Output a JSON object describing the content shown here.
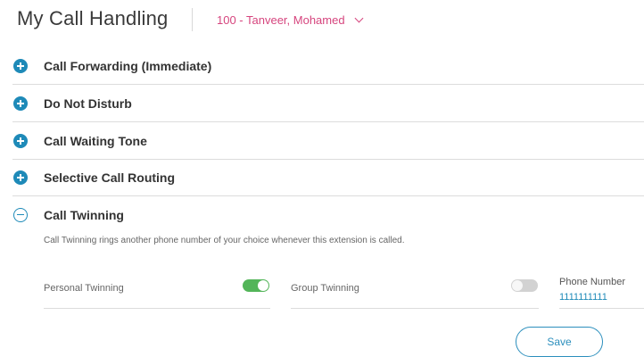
{
  "header": {
    "title": "My Call Handling",
    "extension_selected": "100 - Tanveer, Mohamed"
  },
  "sections": [
    {
      "label": "Call Forwarding (Immediate)",
      "expanded": false
    },
    {
      "label": "Do Not Disturb",
      "expanded": false
    },
    {
      "label": "Call Waiting Tone",
      "expanded": false
    },
    {
      "label": "Selective Call Routing",
      "expanded": false
    }
  ],
  "call_twinning": {
    "label": "Call Twinning",
    "expanded": true,
    "description": "Call Twinning rings another phone number of your choice whenever this extension is called.",
    "personal_twinning": {
      "label": "Personal Twinning",
      "enabled": true
    },
    "group_twinning": {
      "label": "Group Twinning",
      "enabled": false
    },
    "phone_number": {
      "label": "Phone Number",
      "value": "1111111111"
    }
  },
  "actions": {
    "save_label": "Save"
  },
  "colors": {
    "accent_blue": "#1e8ab8",
    "extension_pink": "#d6457e",
    "toggle_on": "#53b559",
    "toggle_off": "#d2d2d2"
  }
}
